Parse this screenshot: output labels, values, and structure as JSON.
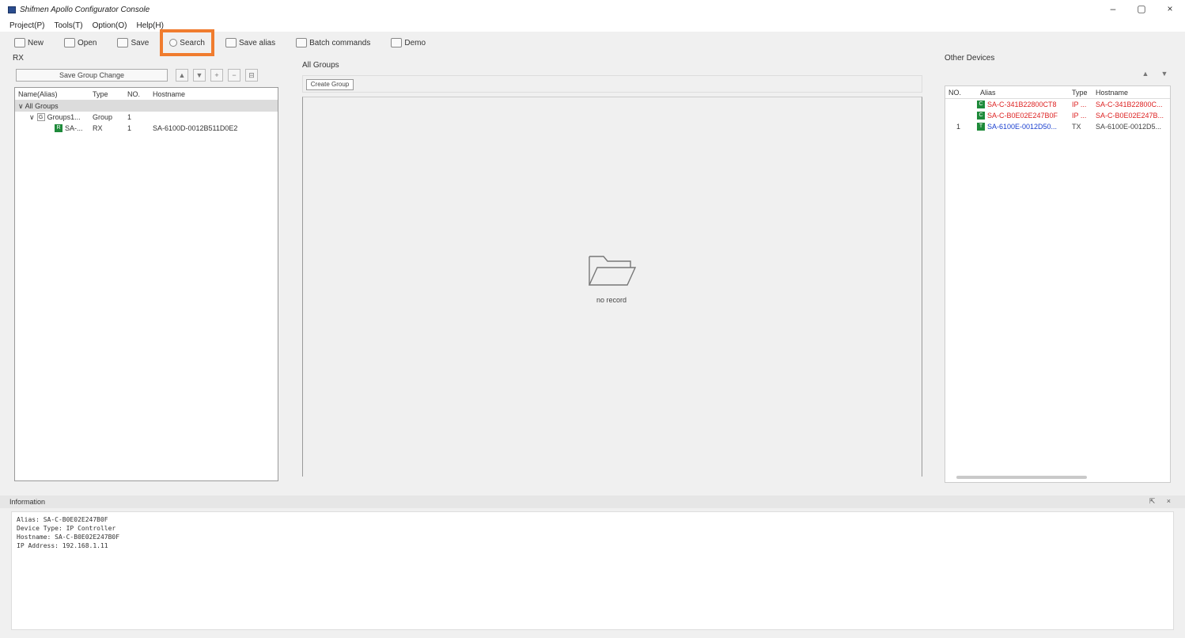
{
  "window": {
    "title": "Shifmen Apollo Configurator Console",
    "minimize": "–",
    "restore": "▢",
    "close": "×"
  },
  "menu": [
    "Project(P)",
    "Tools(T)",
    "Option(O)",
    "Help(H)"
  ],
  "toolbar": {
    "new": "New",
    "open": "Open",
    "save": "Save",
    "search": "Search",
    "save_alias": "Save alias",
    "batch_commands": "Batch commands",
    "demo": "Demo"
  },
  "left": {
    "label": "RX",
    "save_group_change": "Save Group Change",
    "buttons": [
      "▲",
      "▼",
      "+",
      "−",
      "⊟"
    ],
    "columns": [
      "Name(Alias)",
      "Type",
      "NO.",
      "Hostname"
    ],
    "rows": [
      {
        "name": "All Groups",
        "type": "",
        "no": "",
        "host": "",
        "level": 0,
        "badge": "",
        "arrow": "∨"
      },
      {
        "name": "Groups1...",
        "type": "Group",
        "no": "1",
        "host": "",
        "level": 1,
        "badge": "G",
        "arrow": "∨"
      },
      {
        "name": "SA-...",
        "type": "RX",
        "no": "1",
        "host": "SA-6100D-0012B511D0E2",
        "level": 2,
        "badge": "R",
        "arrow": ""
      }
    ]
  },
  "middle": {
    "label": "All Groups",
    "create_group": "Create Group",
    "empty_label": "no record"
  },
  "right": {
    "label": "Other Devices",
    "buttons": [
      "▲",
      "▼"
    ],
    "columns": [
      "NO.",
      "Alias",
      "Type",
      "Hostname"
    ],
    "rows": [
      {
        "no": "",
        "badge": "C",
        "alias": "SA-C-341B22800CT8",
        "type": "IP ...",
        "host": "SA-C-341B22800C...",
        "color": "red"
      },
      {
        "no": "",
        "badge": "C",
        "alias": "SA-C-B0E02E247B0F",
        "type": "IP ...",
        "host": "SA-C-B0E02E247B...",
        "color": "red"
      },
      {
        "no": "1",
        "badge": "T",
        "alias": "SA-6100E-0012D50...",
        "type": "TX",
        "host": "SA-6100E-0012D5...",
        "color": "blue"
      }
    ]
  },
  "info": {
    "header": "Information",
    "dock_buttons": "⇱ ×",
    "lines": [
      "Alias: SA-C-B0E02E247B0F",
      "Device Type: IP Controller",
      "Hostname: SA-C-B0E02E247B0F",
      "IP Address: 192.168.1.11"
    ]
  }
}
